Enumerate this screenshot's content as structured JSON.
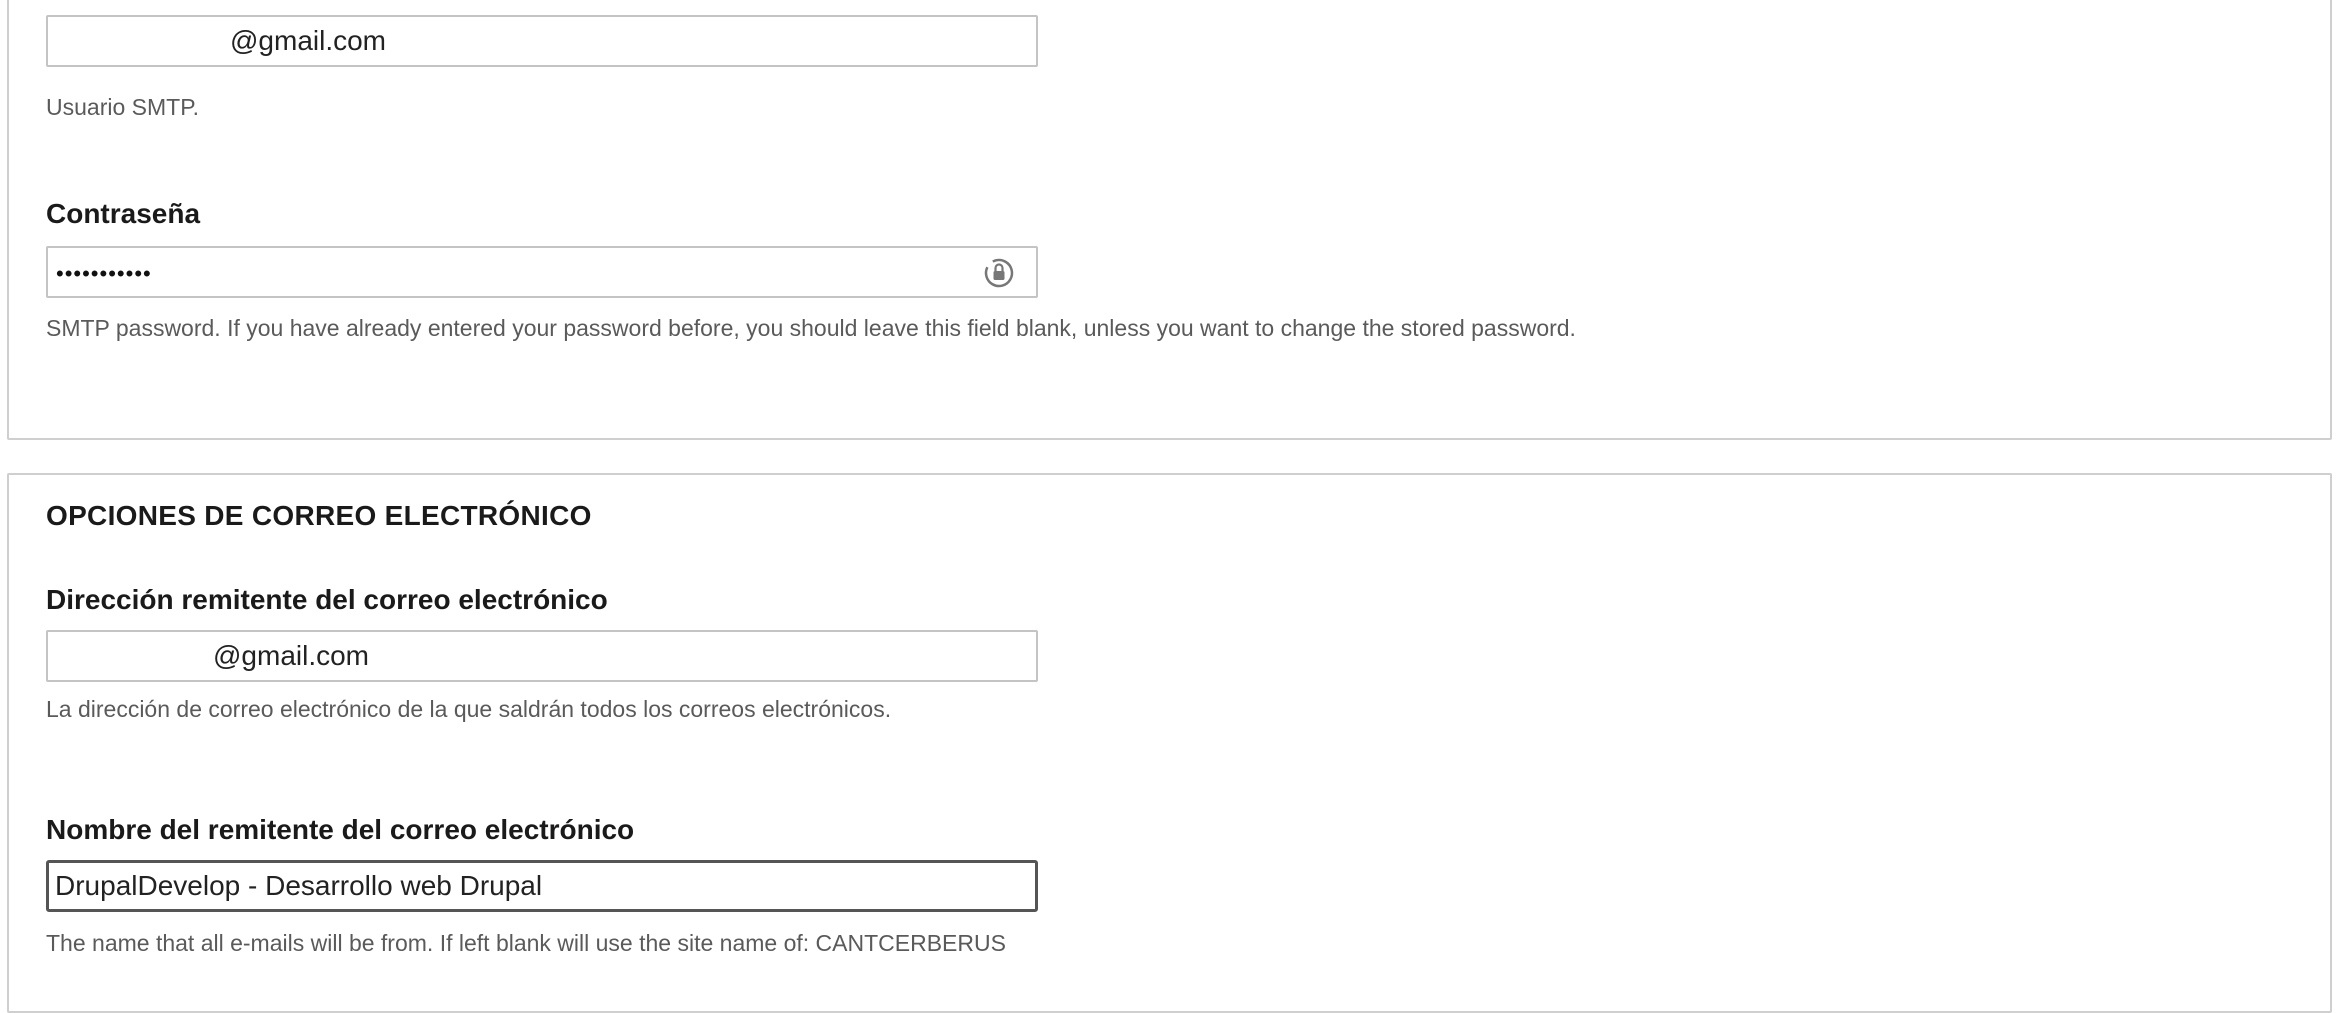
{
  "smtp_user": {
    "value": "@gmail.com",
    "description": "Usuario SMTP."
  },
  "smtp_password": {
    "label": "Contraseña",
    "masked_value": "•••••••••••",
    "description": "SMTP password. If you have already entered your password before, you should leave this field blank, unless you want to change the stored password.",
    "icon": "password-manager-icon"
  },
  "email_options": {
    "legend": "OPCIONES DE CORREO ELECTRÓNICO",
    "from_address": {
      "label": "Dirección remitente del correo electrónico",
      "value": "@gmail.com",
      "description": "La dirección de correo electrónico de la que saldrán todos los correos electrónicos."
    },
    "from_name": {
      "label": "Nombre del remitente del correo electrónico",
      "value": "DrupalDevelop - Desarrollo web Drupal",
      "description": "The name that all e-mails will be from. If left blank will use the site name of: CANTCERBERUS"
    }
  }
}
